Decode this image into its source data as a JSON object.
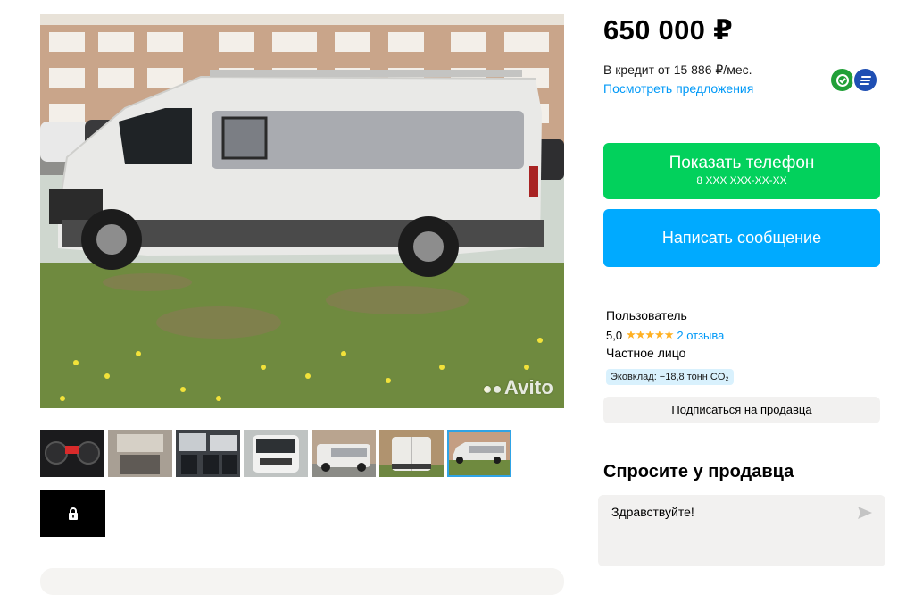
{
  "listing": {
    "price": "650 000 ₽",
    "credit_text": "В кредит от 15 886 ₽/мес.",
    "credit_link": "Посмотреть предложения"
  },
  "gallery": {
    "watermark": "Avito",
    "thumbnails": [
      {
        "icon": "dashboard-photo"
      },
      {
        "icon": "interior-photo"
      },
      {
        "icon": "seats-photo"
      },
      {
        "icon": "van-front-photo"
      },
      {
        "icon": "van-side-photo"
      },
      {
        "icon": "van-rear-photo"
      },
      {
        "icon": "van-grass-photo",
        "selected": true
      }
    ],
    "lock_icon": "lock-icon"
  },
  "actions": {
    "phone_label": "Показать телефон",
    "phone_masked": "8 XXX XXX-XX-XX",
    "message_label": "Написать сообщение"
  },
  "seller": {
    "name": "Пользователь",
    "rating": "5,0",
    "stars": "★★★★★",
    "reviews": "2 отзыва",
    "type": "Частное лицо",
    "eco": "Эковклад: −18,8 тонн CO₂",
    "subscribe_label": "Подписаться на продавца"
  },
  "ask": {
    "title": "Спросите у продавца",
    "input_value": "Здравствуйте!"
  },
  "colors": {
    "green_button": "#02d15c",
    "blue_button": "#00aaff",
    "link": "#0099f7",
    "stars": "#ffb021"
  }
}
